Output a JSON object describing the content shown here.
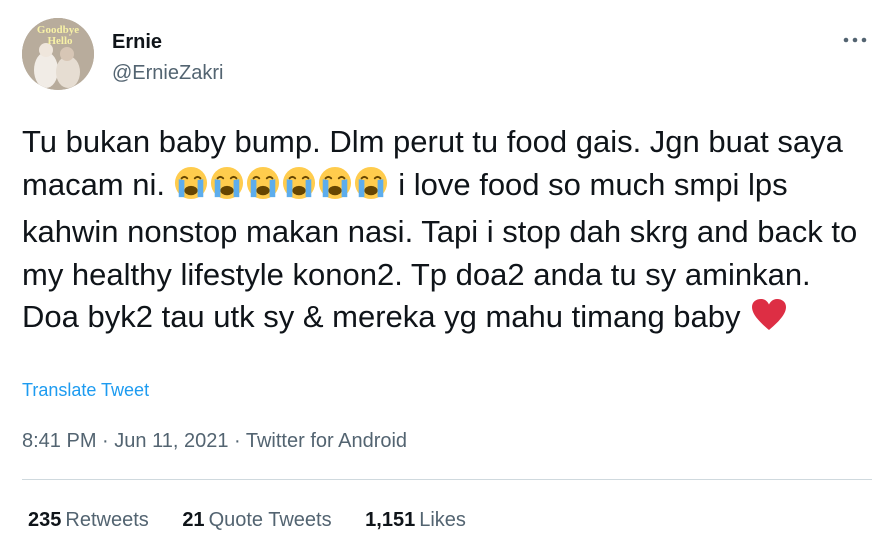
{
  "author": {
    "display_name": "Ernie",
    "handle": "@ErnieZakri",
    "avatar_overlay_text": [
      "Goodbye",
      "Hello"
    ]
  },
  "tweet": {
    "text_part1": "Tu bukan baby bump. Dlm perut tu food gais. Jgn buat saya macam ni. ",
    "emojis": [
      "loudly-crying-face",
      "loudly-crying-face",
      "loudly-crying-face",
      "loudly-crying-face",
      "loudly-crying-face",
      "loudly-crying-face"
    ],
    "text_part2": " i love food so much smpi lps kahwin nonstop makan nasi. Tapi i stop dah skrg and back to my healthy lifestyle konon2. Tp doa2 anda tu sy aminkan. Doa byk2 tau utk sy & mereka yg mahu timang baby ",
    "end_emoji": "red-heart",
    "translate_label": "Translate Tweet"
  },
  "meta": {
    "time": "8:41 PM",
    "separator": " · ",
    "date": "Jun 11, 2021",
    "source": "Twitter for Android"
  },
  "stats": {
    "retweets_count": "235",
    "retweets_label": "Retweets",
    "quote_count": "21",
    "quote_label": "Quote Tweets",
    "likes_count": "1,151",
    "likes_label": "Likes"
  },
  "colors": {
    "link": "#1d9bf0",
    "secondary_text": "#536471",
    "primary_text": "#0f1419",
    "divider": "#cfd9de",
    "heart": "#e0245e",
    "emoji_face": "#ffcc4d"
  }
}
